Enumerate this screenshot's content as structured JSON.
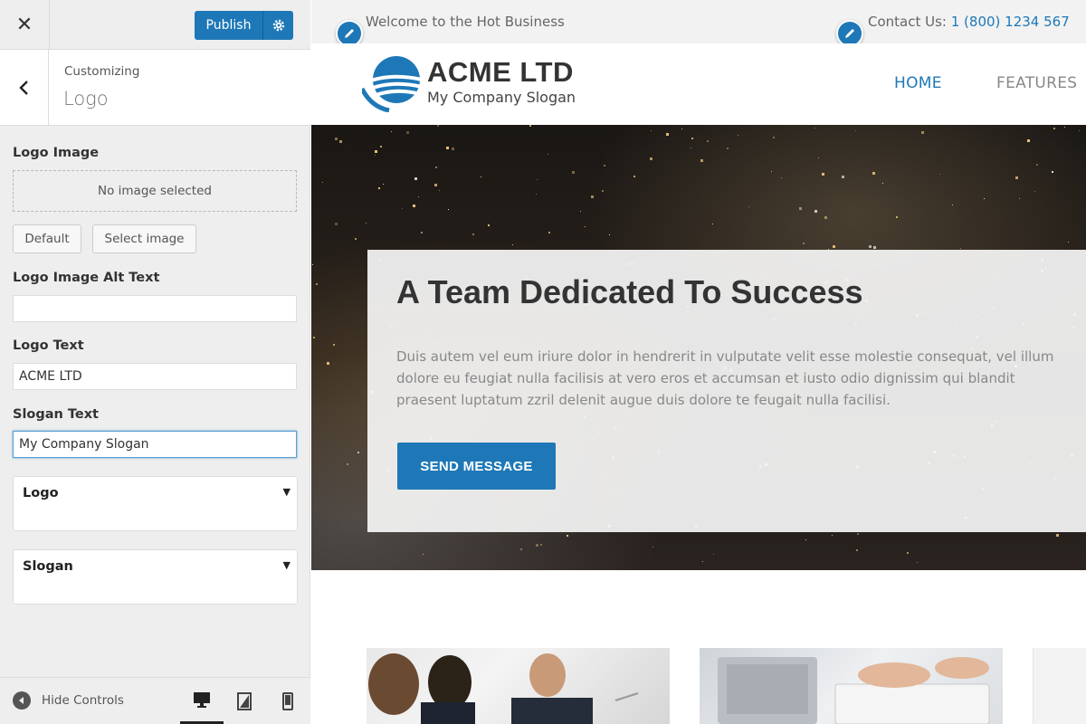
{
  "header": {
    "close_glyph": "✕",
    "publish_label": "Publish"
  },
  "section": {
    "subtitle": "Customizing",
    "title": "Logo"
  },
  "form": {
    "logo_image_label": "Logo Image",
    "no_image_text": "No image selected",
    "default_button": "Default",
    "select_image_button": "Select image",
    "alt_text_label": "Logo Image Alt Text",
    "alt_text_value": "",
    "logo_text_label": "Logo Text",
    "logo_text_value": "ACME LTD",
    "slogan_text_label": "Slogan Text",
    "slogan_text_value": "My Company Slogan",
    "logo_dropdown_label": "Logo",
    "slogan_dropdown_label": "Slogan",
    "dropdown_arrow": "▼"
  },
  "footer": {
    "hide_controls_label": "Hide Controls",
    "devices": [
      "desktop",
      "tablet",
      "mobile"
    ],
    "active_device": "desktop"
  },
  "preview": {
    "welcome_text": "Welcome to the Hot Business",
    "contact_prefix": "Contact Us: ",
    "contact_phone": "1 (800) 1234 567",
    "site_title": "ACME LTD",
    "site_slogan": "My Company Slogan",
    "nav": [
      "HOME",
      "FEATURES"
    ],
    "active_nav": "HOME",
    "hero_title": "A Team Dedicated To Success",
    "hero_body": "Duis autem vel eum iriure dolor in hendrerit in vulputate velit esse molestie consequat, vel illum dolore eu feugiat nulla facilisis at vero eros et accumsan et iusto odio dignissim qui blandit praesent luptatum zzril delenit augue duis dolore te feugait nulla facilisi.",
    "hero_button": "SEND MESSAGE"
  },
  "colors": {
    "accent": "#1e78b7",
    "sidebar_bg": "#eeeeee",
    "topbar_bg": "#f2f2f2"
  }
}
